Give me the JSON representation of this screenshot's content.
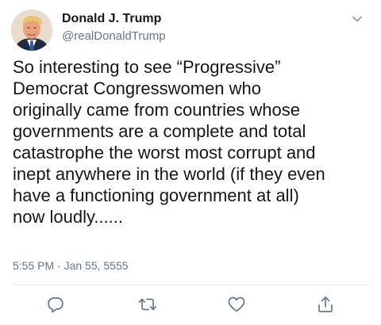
{
  "tweet": {
    "display_name": "Donald J. Trump",
    "handle": "@realDonaldTrump",
    "text": "So interesting to see “Progressive”\nDemocrat Congresswomen who\noriginally came from countries whose\ngovernments are a complete and total\ncatastrophe the worst most corrupt and\ninept anywhere in the world (if they even\nhave a functioning government at all)\nnow loudly......",
    "timestamp": "5:55 PM · Jan 55, 5555"
  },
  "icons": {
    "menu": "chevron-down-icon",
    "reply": "reply-icon",
    "retweet": "retweet-icon",
    "like": "heart-icon",
    "share": "share-icon"
  },
  "colors": {
    "text": "#14171a",
    "secondary": "#657786",
    "icon": "#657786",
    "divider": "#e6ecf0"
  }
}
